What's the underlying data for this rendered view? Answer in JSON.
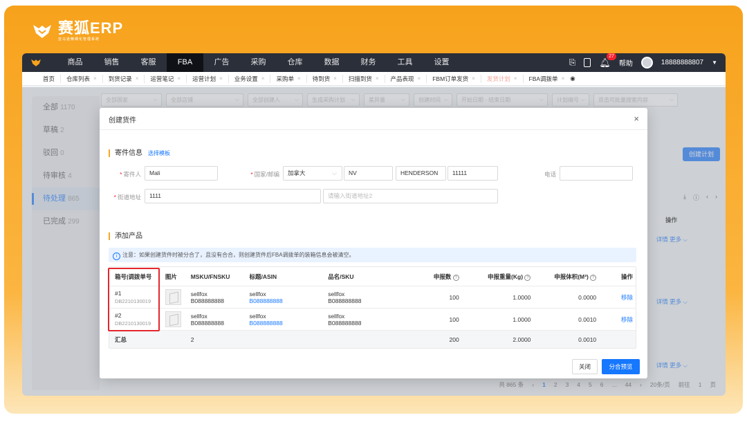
{
  "brand": {
    "name": "赛狐ERP",
    "tagline": "亚马逊精细化管理系统"
  },
  "nav": {
    "items": [
      "商品",
      "销售",
      "客服",
      "FBA",
      "广告",
      "采购",
      "仓库",
      "数据",
      "财务",
      "工具",
      "设置"
    ],
    "active": "FBA",
    "help": "帮助",
    "phone": "18888888807",
    "badge": "27"
  },
  "tabs": [
    {
      "label": "首页",
      "closable": false,
      "state": ""
    },
    {
      "label": "仓库列表",
      "closable": true,
      "state": ""
    },
    {
      "label": "到货记录",
      "closable": true,
      "state": ""
    },
    {
      "label": "运营笔记",
      "closable": true,
      "state": ""
    },
    {
      "label": "运营计划",
      "closable": true,
      "state": ""
    },
    {
      "label": "业务设置",
      "closable": true,
      "state": ""
    },
    {
      "label": "采购单",
      "closable": true,
      "state": ""
    },
    {
      "label": "待到货",
      "closable": true,
      "state": ""
    },
    {
      "label": "扫描到货",
      "closable": true,
      "state": ""
    },
    {
      "label": "产品表现",
      "closable": true,
      "state": ""
    },
    {
      "label": "FBM订单发货",
      "closable": true,
      "state": ""
    },
    {
      "label": "发货计划",
      "closable": true,
      "state": "warn"
    },
    {
      "label": "FBA调拨单",
      "closable": true,
      "state": ""
    }
  ],
  "sidebar": [
    {
      "label": "全部",
      "count": "1170"
    },
    {
      "label": "草稿",
      "count": "2"
    },
    {
      "label": "驳回",
      "count": "0"
    },
    {
      "label": "待审核",
      "count": "4"
    },
    {
      "label": "待处理",
      "count": "865"
    },
    {
      "label": "已完成",
      "count": "299"
    }
  ],
  "filters": [
    "全部国家",
    "全部店铺",
    "全部创建人",
    "生成采购计划",
    "差异量",
    "创建时间",
    "开始日期 - 结束日期",
    "计划编号",
    "双击可批量搜索内容"
  ],
  "page": {
    "create_button": "创建计划",
    "operate_header": "操作",
    "detail": "详情",
    "more": "更多",
    "pager": {
      "total": "共 865 条",
      "pages": [
        "1",
        "2",
        "3",
        "4",
        "5",
        "6",
        "...",
        "44"
      ],
      "current": "1",
      "per_page": "20条/页",
      "goto": "前往",
      "goto_page": "1",
      "page_unit": "页"
    }
  },
  "modal": {
    "title": "创建货件",
    "sender_section": "寄件信息",
    "select_template": "选择模板",
    "labels": {
      "sender": "寄件人",
      "country": "国家/邮编",
      "phone": "电话",
      "street": "街道地址"
    },
    "values": {
      "sender": "Mali",
      "country": "加拿大",
      "state": "NV",
      "city": "HENDERSON",
      "zip": "11111",
      "phone": "",
      "street1": "1111"
    },
    "placeholders": {
      "street2": "请输入街道地址2"
    },
    "product_section": "添加产品",
    "notice": "注意：如果创建货件时被分合了，且没有合合，则创建货件后FBA调拨单的装箱信息会被清空。",
    "table": {
      "headers": [
        "箱号|调拨单号",
        "图片",
        "MSKU/FNSKU",
        "标题/ASIN",
        "品名/SKU",
        "申报数",
        "申报重量(Kg)",
        "申报体积(M³)",
        "操作"
      ],
      "rows": [
        {
          "box": "#1",
          "order": "DB2210130019",
          "msku": "sellfox",
          "fnsku": "B088888888",
          "title": "sellfox",
          "asin": "B088888888",
          "name": "sellfox",
          "sku": "B088888888",
          "qty": "100",
          "weight": "1.0000",
          "volume": "0.0000",
          "action": "移除"
        },
        {
          "box": "#2",
          "order": "DB2210130019",
          "msku": "sellfox",
          "fnsku": "B088888888",
          "title": "sellfox",
          "asin": "B088888888",
          "name": "sellfox",
          "sku": "B088888888",
          "qty": "100",
          "weight": "1.0000",
          "volume": "0.0010",
          "action": "移除"
        }
      ],
      "summary": {
        "label": "汇总",
        "count": "2",
        "qty": "200",
        "weight": "2.0000",
        "volume": "0.0010"
      }
    },
    "close": "关闭",
    "preview": "分合预览"
  },
  "colors": {
    "accent": "#1677ff",
    "brand": "#f7a21c",
    "highlight": "#e5262d"
  }
}
